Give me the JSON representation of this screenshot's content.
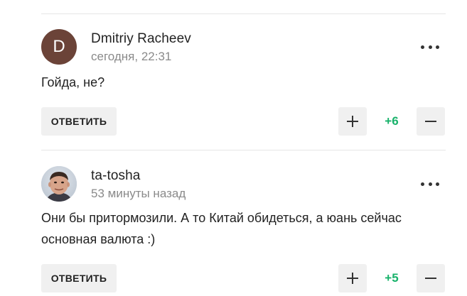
{
  "comments": [
    {
      "author": "Dmitriy Racheev",
      "avatar_letter": "D",
      "time": "сегодня, 22:31",
      "text": "Гойда, не?",
      "reply_label": "ОТВЕТИТЬ",
      "score": "+6"
    },
    {
      "author": "ta-tosha",
      "time": "53 минуты назад",
      "text": "Они бы притормозили. А то Китай обидеться, а юань сейчас основная валюта :)",
      "reply_label": "ОТВЕТИТЬ",
      "score": "+5"
    }
  ],
  "icons": {
    "more": "more-options-icon",
    "plus": "plus-icon",
    "minus": "minus-icon"
  },
  "colors": {
    "score": "#17b26a",
    "avatar_bg": "#6b4338",
    "button_bg": "#f0f0f0",
    "divider": "#e6e6e6"
  }
}
